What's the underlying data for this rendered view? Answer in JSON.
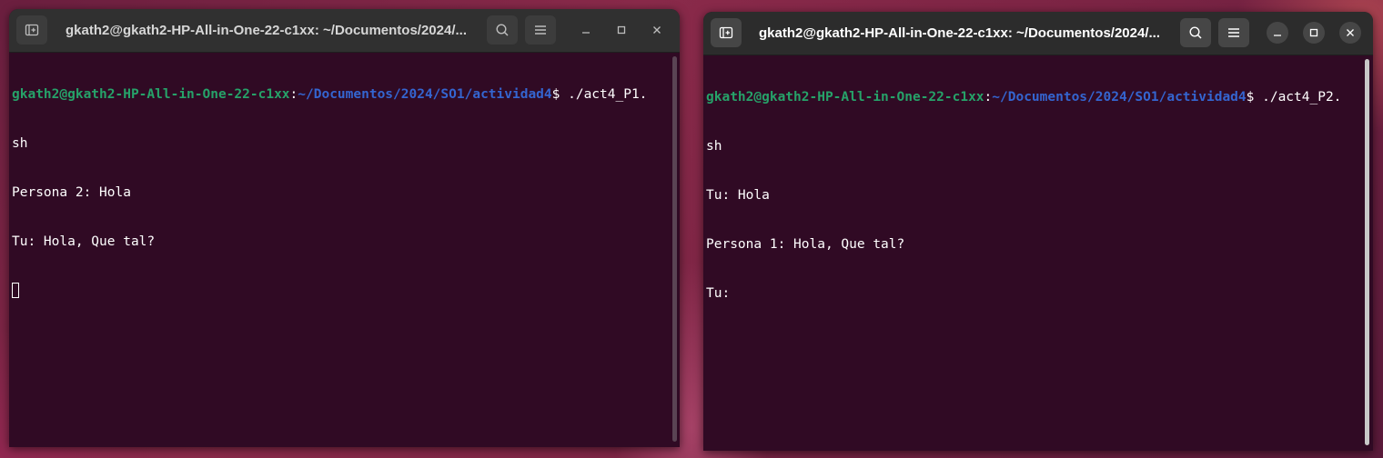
{
  "colors": {
    "terminal_bg": "#300a24",
    "prompt_user": "#26a269",
    "prompt_path": "#3465d0",
    "titlebar_active": "#2c2c2c",
    "titlebar_inactive": "#303030"
  },
  "windows": [
    {
      "title": "gkath2@gkath2-HP-All-in-One-22-c1xx: ~/Documentos/2024/...",
      "icons": {
        "new_tab": "new-tab-icon",
        "search": "search-icon",
        "menu": "hamburger-menu-icon",
        "minimize": "minimize-icon",
        "maximize": "maximize-icon",
        "close": "close-icon"
      },
      "prompt": {
        "user_host": "gkath2@gkath2-HP-All-in-One-22-c1xx",
        "colon": ":",
        "path": "~/Documentos/2024/SO1/actividad4",
        "symbol": "$",
        "command": " ./act4_P1.",
        "wrap": "sh"
      },
      "output": [
        "Persona 2: Hola",
        "Tu: Hola, Que tal?"
      ]
    },
    {
      "title": "gkath2@gkath2-HP-All-in-One-22-c1xx: ~/Documentos/2024/...",
      "icons": {
        "new_tab": "new-tab-icon",
        "search": "search-icon",
        "menu": "hamburger-menu-icon",
        "minimize": "minimize-icon",
        "maximize": "maximize-icon",
        "close": "close-icon"
      },
      "prompt": {
        "user_host": "gkath2@gkath2-HP-All-in-One-22-c1xx",
        "colon": ":",
        "path": "~/Documentos/2024/SO1/actividad4",
        "symbol": "$",
        "command": " ./act4_P2.",
        "wrap": "sh"
      },
      "output": [
        "Tu: Hola",
        "Persona 1: Hola, Que tal?",
        "Tu:"
      ]
    }
  ]
}
